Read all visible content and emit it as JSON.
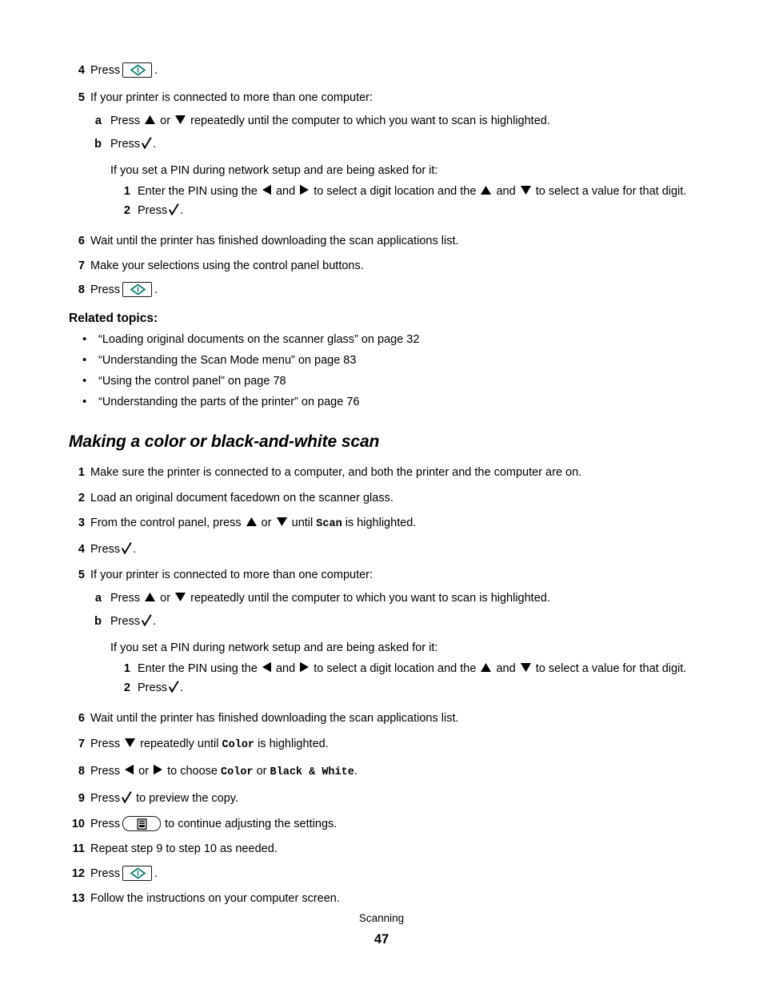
{
  "page": {
    "footer_label": "Scanning",
    "page_number": "47",
    "accent_color": "#0a7a6e"
  },
  "procedure_one": {
    "step4": {
      "num": "4",
      "press": "Press",
      "period": "."
    },
    "step5": {
      "num": "5",
      "text": "If your printer is connected to more than one computer:"
    },
    "step5a": {
      "marker": "a",
      "press": "Press",
      "or": "or",
      "rest": "repeatedly until the computer to which you want to scan is highlighted."
    },
    "step5b": {
      "marker": "b",
      "press": "Press",
      "period": "."
    },
    "pin_note": "If you set a PIN during network setup and are being asked for it:",
    "pin1": {
      "num": "1",
      "part1": "Enter the PIN using the",
      "part2": "and",
      "part3": "to select a digit location and the",
      "part4": "and",
      "part5": "to select a value for that digit."
    },
    "pin2": {
      "num": "2",
      "press": "Press",
      "period": "."
    },
    "step6": {
      "num": "6",
      "text": "Wait until the printer has finished downloading the scan applications list."
    },
    "step7": {
      "num": "7",
      "text": "Make your selections using the control panel buttons."
    },
    "step8": {
      "num": "8",
      "press": "Press",
      "period": "."
    }
  },
  "related": {
    "heading": "Related topics:",
    "bullet": "•",
    "items": [
      "“Loading original documents on the scanner glass” on page 32",
      "“Understanding the Scan Mode menu” on page 83",
      "“Using the control panel” on page 78",
      "“Understanding the parts of the printer” on page 76"
    ]
  },
  "section": {
    "heading": "Making a color or black-and-white scan"
  },
  "procedure_two": {
    "step1": {
      "num": "1",
      "text": "Make sure the printer is connected to a computer, and both the printer and the computer are on."
    },
    "step2": {
      "num": "2",
      "text": "Load an original document facedown on the scanner glass."
    },
    "step3": {
      "num": "3",
      "part1": "From the control panel, press",
      "or": "or",
      "part2": "until",
      "mono": "Scan",
      "part3": "is highlighted."
    },
    "step4": {
      "num": "4",
      "press": "Press",
      "period": "."
    },
    "step5": {
      "num": "5",
      "text": "If your printer is connected to more than one computer:"
    },
    "step5a": {
      "marker": "a",
      "press": "Press",
      "or": "or",
      "rest": "repeatedly until the computer to which you want to scan is highlighted."
    },
    "step5b": {
      "marker": "b",
      "press": "Press",
      "period": "."
    },
    "pin_note": "If you set a PIN during network setup and are being asked for it:",
    "pin1": {
      "num": "1",
      "part1": "Enter the PIN using the",
      "part2": "and",
      "part3": "to select a digit location and the",
      "part4": "and",
      "part5": "to select a value for that digit."
    },
    "pin2": {
      "num": "2",
      "press": "Press",
      "period": "."
    },
    "step6": {
      "num": "6",
      "text": "Wait until the printer has finished downloading the scan applications list."
    },
    "step7": {
      "num": "7",
      "part1": "Press",
      "part2": "repeatedly until",
      "mono": "Color",
      "part3": "is highlighted."
    },
    "step8": {
      "num": "8",
      "part1": "Press",
      "or": "or",
      "part2": "to choose",
      "mono1": "Color",
      "part3": "or",
      "mono2": "Black & White",
      "period": "."
    },
    "step9": {
      "num": "9",
      "part1": "Press",
      "part2": "to preview the copy."
    },
    "step10": {
      "num": "10",
      "part1": "Press",
      "part2": "to continue adjusting the settings."
    },
    "step11": {
      "num": "11",
      "text": "Repeat step 9 to step 10 as needed."
    },
    "step12": {
      "num": "12",
      "press": "Press",
      "period": "."
    },
    "step13": {
      "num": "13",
      "text": "Follow the instructions on your computer screen."
    }
  }
}
